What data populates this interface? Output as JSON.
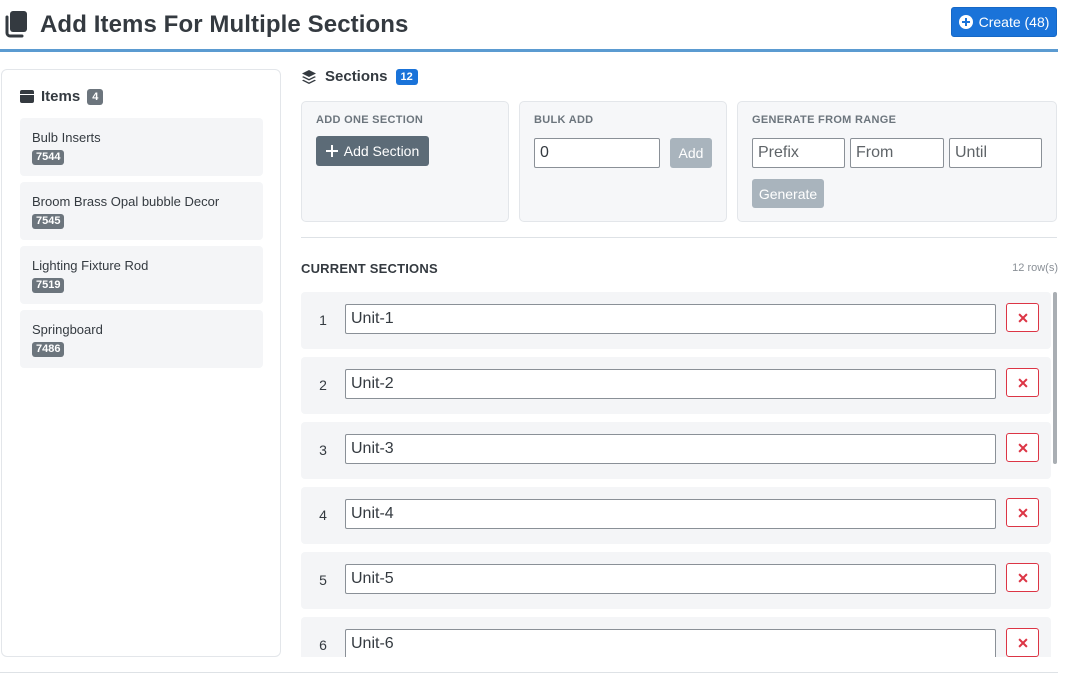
{
  "header": {
    "title": "Add Items For Multiple Sections",
    "icon": "copy-icon",
    "create_label": "Create (48)"
  },
  "items_panel": {
    "label": "Items",
    "count": "4",
    "icon": "box-icon",
    "items": [
      {
        "name": "Bulb Inserts",
        "code": "7544"
      },
      {
        "name": "Broom Brass Opal bubble Decor",
        "code": "7545"
      },
      {
        "name": "Lighting Fixture Rod",
        "code": "7519"
      },
      {
        "name": "Springboard",
        "code": "7486"
      }
    ]
  },
  "sections": {
    "label": "Sections",
    "count": "12",
    "icon": "layers-icon",
    "add_one": {
      "caption": "ADD ONE SECTION",
      "button_label": "Add Section"
    },
    "bulk_add": {
      "caption": "BULK ADD",
      "value": "0",
      "button_label": "Add"
    },
    "generate": {
      "caption": "GENERATE FROM RANGE",
      "prefix_placeholder": "Prefix",
      "from_placeholder": "From",
      "until_placeholder": "Until",
      "button_label": "Generate"
    },
    "current_title": "CURRENT SECTIONS",
    "row_count": "12 row(s)",
    "rows": [
      {
        "num": "1",
        "value": "Unit-1"
      },
      {
        "num": "2",
        "value": "Unit-2"
      },
      {
        "num": "3",
        "value": "Unit-3"
      },
      {
        "num": "4",
        "value": "Unit-4"
      },
      {
        "num": "5",
        "value": "Unit-5"
      },
      {
        "num": "6",
        "value": "Unit-6"
      }
    ]
  },
  "colors": {
    "primary": "#1a73d9",
    "secondary": "#5c6b77",
    "danger": "#dc3545",
    "header_rule": "#5b9bd1"
  }
}
